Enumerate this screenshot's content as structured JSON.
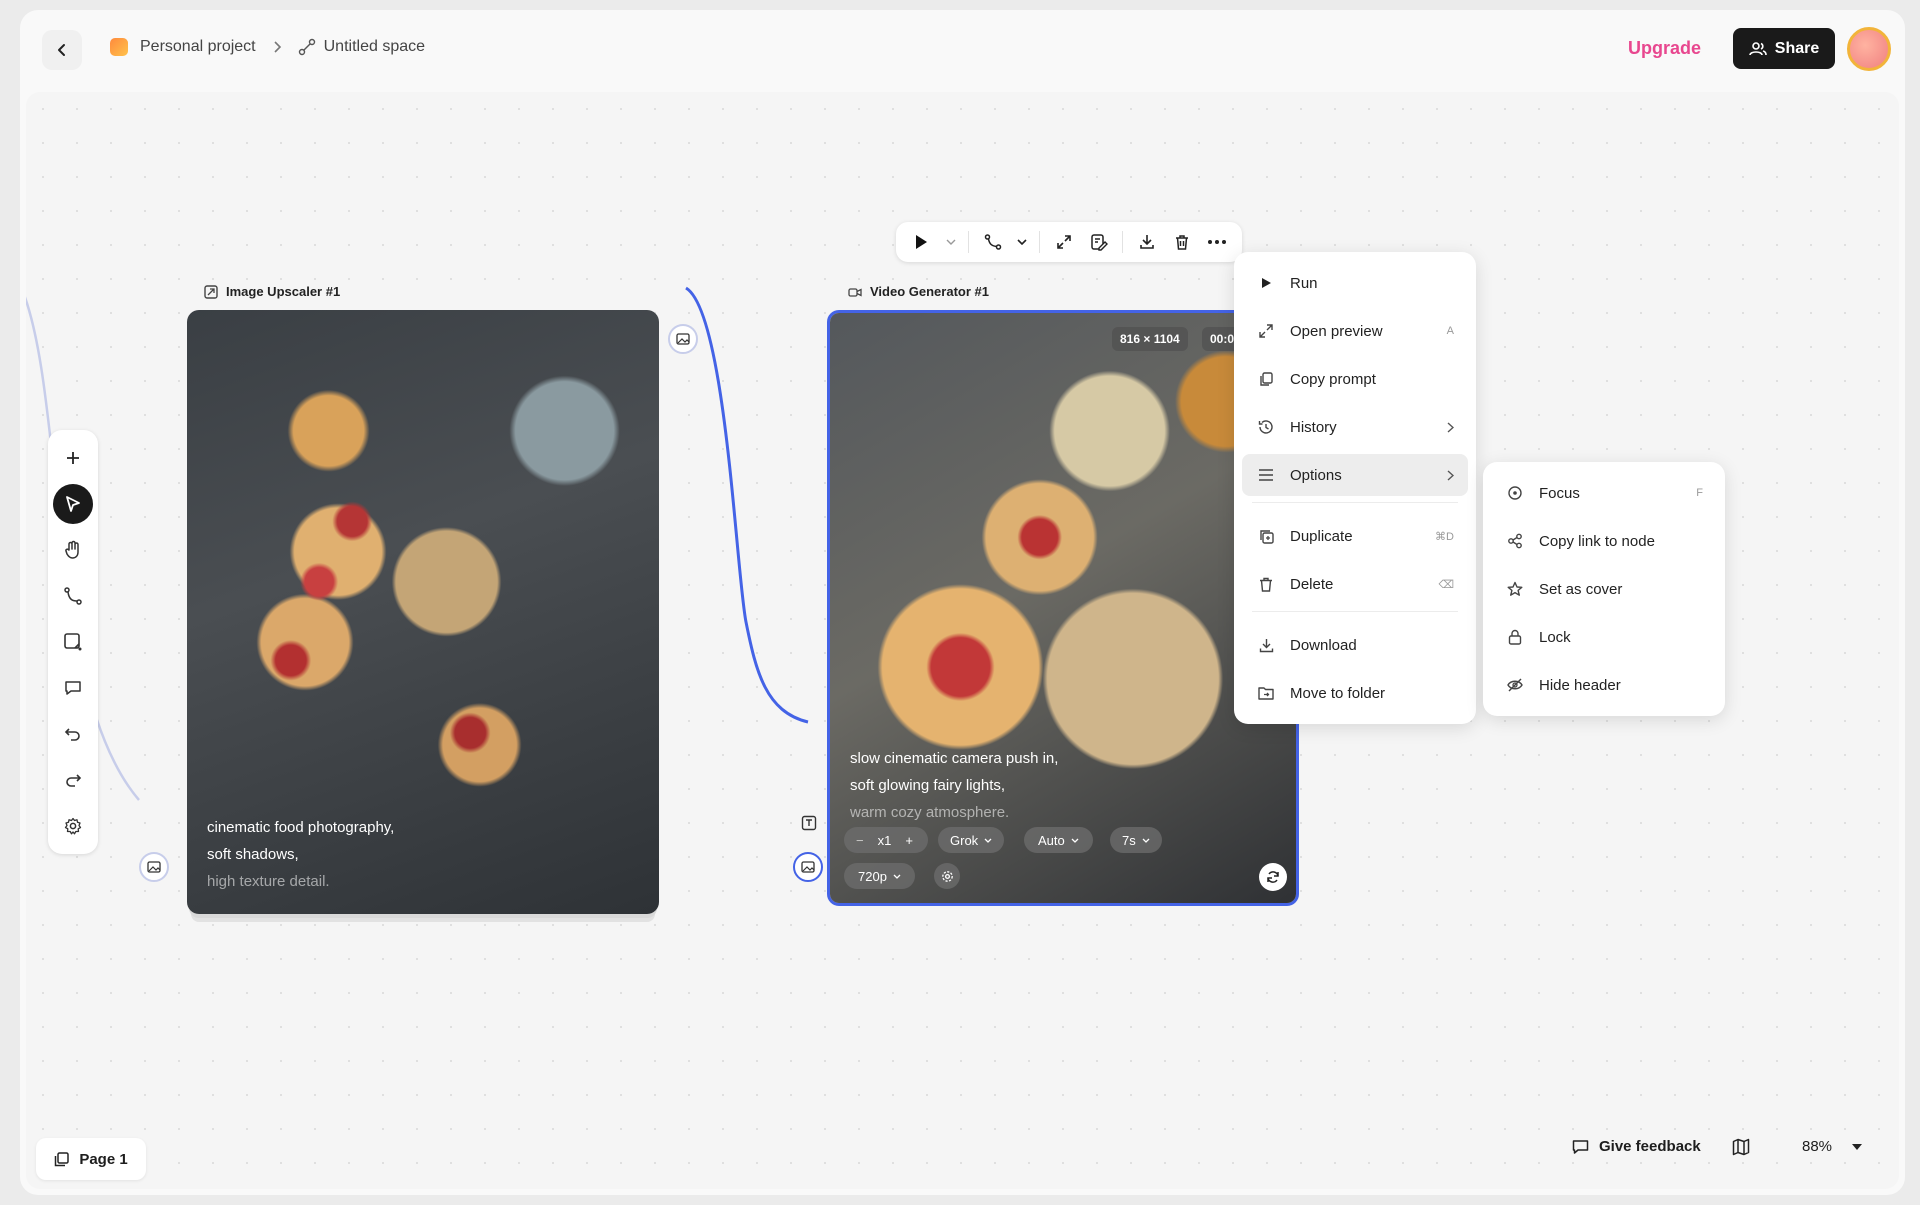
{
  "breadcrumb": {
    "project": "Personal project",
    "space": "Untitled space"
  },
  "header": {
    "upgrade_label": "Upgrade",
    "share_label": "Share"
  },
  "nodes": {
    "upscaler": {
      "title": "Image Upscaler #1",
      "caption": [
        "cinematic food photography,",
        "soft shadows,",
        "high texture detail."
      ]
    },
    "video": {
      "title": "Video Generator #1",
      "resolution_badge": "816 × 1104",
      "duration_badge": "00:0",
      "caption": [
        "slow cinematic camera push in,",
        "soft glowing fairy lights,",
        "warm cozy atmosphere."
      ],
      "controls": {
        "minus": "−",
        "count": "x1",
        "plus": "+",
        "model": "Grok",
        "mode": "Auto",
        "length": "7s",
        "quality": "720p"
      }
    }
  },
  "context_menu": {
    "items": [
      {
        "label": "Run",
        "icon": "play-icon",
        "shortcut": ""
      },
      {
        "label": "Open preview",
        "icon": "expand-icon",
        "shortcut": "A"
      },
      {
        "label": "Copy prompt",
        "icon": "copy-icon",
        "shortcut": ""
      },
      {
        "label": "History",
        "icon": "history-icon",
        "shortcut": ""
      },
      {
        "label": "Options",
        "icon": "menu-lines-icon",
        "shortcut": ""
      }
    ],
    "items2": [
      {
        "label": "Duplicate",
        "icon": "duplicate-icon",
        "shortcut": "⌘D"
      },
      {
        "label": "Delete",
        "icon": "trash-icon",
        "shortcut": "⌫"
      }
    ],
    "items3": [
      {
        "label": "Download",
        "icon": "download-icon"
      },
      {
        "label": "Move to folder",
        "icon": "folder-move-icon"
      }
    ]
  },
  "submenu": {
    "items": [
      {
        "label": "Focus",
        "icon": "focus-icon",
        "shortcut": "F"
      },
      {
        "label": "Copy link to node",
        "icon": "share-link-icon",
        "shortcut": ""
      },
      {
        "label": "Set as cover",
        "icon": "star-icon",
        "shortcut": ""
      },
      {
        "label": "Lock",
        "icon": "lock-icon",
        "shortcut": ""
      },
      {
        "label": "Hide header",
        "icon": "eye-off-icon",
        "shortcut": ""
      }
    ]
  },
  "footer": {
    "page_label": "Page 1",
    "feedback_label": "Give feedback",
    "zoom": "88%"
  },
  "colors": {
    "accent": "#4463e6",
    "upgrade": "#e8478f",
    "dark": "#1a1a1a"
  }
}
